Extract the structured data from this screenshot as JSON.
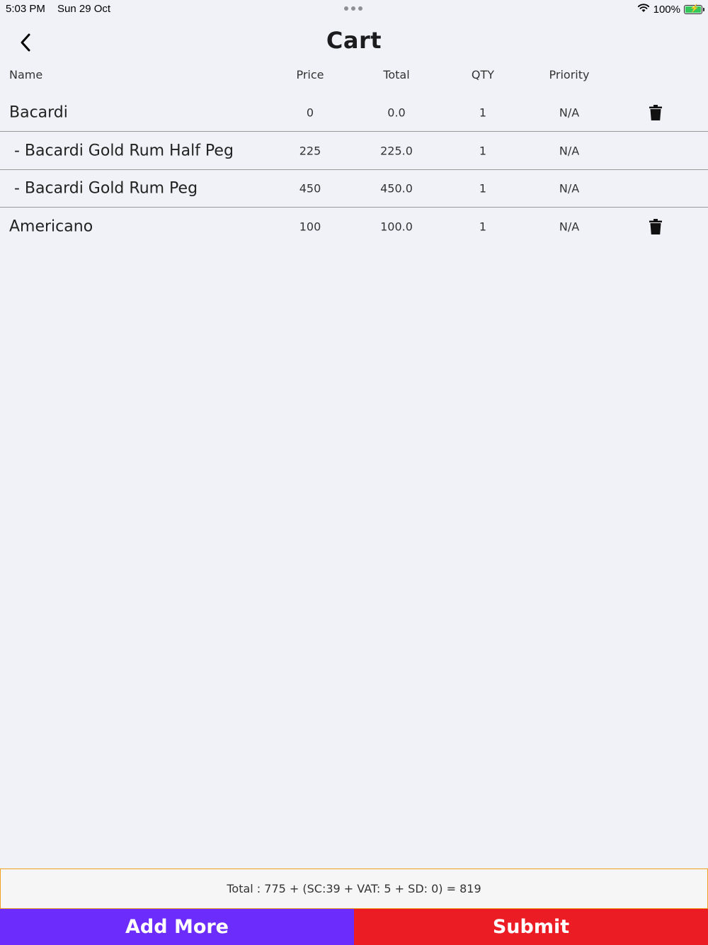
{
  "status_bar": {
    "time": "5:03 PM",
    "date": "Sun 29 Oct",
    "battery": "100%",
    "battery_level": 1.0
  },
  "header": {
    "title": "Cart",
    "back_icon": "chevron-left-icon"
  },
  "table": {
    "columns": {
      "name": "Name",
      "price": "Price",
      "total": "Total",
      "qty": "QTY",
      "priority": "Priority"
    },
    "rows": [
      {
        "name": "Bacardi",
        "price": "0",
        "total": "0.0",
        "qty": "1",
        "priority": "N/A",
        "deletable": true,
        "sub": false
      },
      {
        "name": " - Bacardi Gold Rum Half Peg",
        "price": "225",
        "total": "225.0",
        "qty": "1",
        "priority": "N/A",
        "deletable": false,
        "sub": true
      },
      {
        "name": " - Bacardi Gold Rum Peg",
        "price": "450",
        "total": "450.0",
        "qty": "1",
        "priority": "N/A",
        "deletable": false,
        "sub": true
      },
      {
        "name": "Americano",
        "price": "100",
        "total": "100.0",
        "qty": "1",
        "priority": "N/A",
        "deletable": true,
        "sub": false
      }
    ]
  },
  "summary": {
    "text": "Total : 775 + (SC:39 + VAT: 5 + SD: 0) = 819"
  },
  "actions": {
    "add_more_label": "Add More",
    "submit_label": "Submit",
    "add_more_color": "#6c2cfb",
    "submit_color": "#ec1c24"
  },
  "colors": {
    "background": "#f0f2f7",
    "summary_border": "#f0a020"
  }
}
